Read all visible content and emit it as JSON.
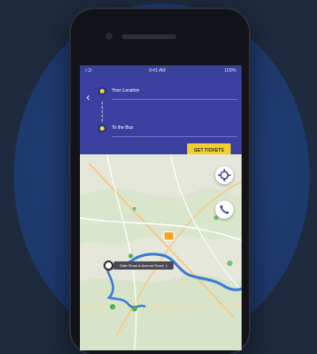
{
  "status_bar": {
    "carrier": "Ꭵ ❍",
    "time": "9:41 AM",
    "battery": "100%"
  },
  "route": {
    "from_label": "Your Location",
    "to_label": "To the Bus"
  },
  "header": {
    "action_button": "GET TICKETS"
  },
  "map": {
    "tooltip": "Gate Road & Avenue Road, 1"
  },
  "colors": {
    "background": "#1e2a3d",
    "circle": "#1f3b70",
    "header": "#3b3fa0",
    "accent": "#f2cf2f",
    "route": "#3a7bd5"
  },
  "icons": {
    "back": "chevron-left-icon",
    "origin": "location-pin-icon",
    "destination": "location-pin-icon",
    "target": "crosshair-icon",
    "phone": "phone-icon"
  }
}
